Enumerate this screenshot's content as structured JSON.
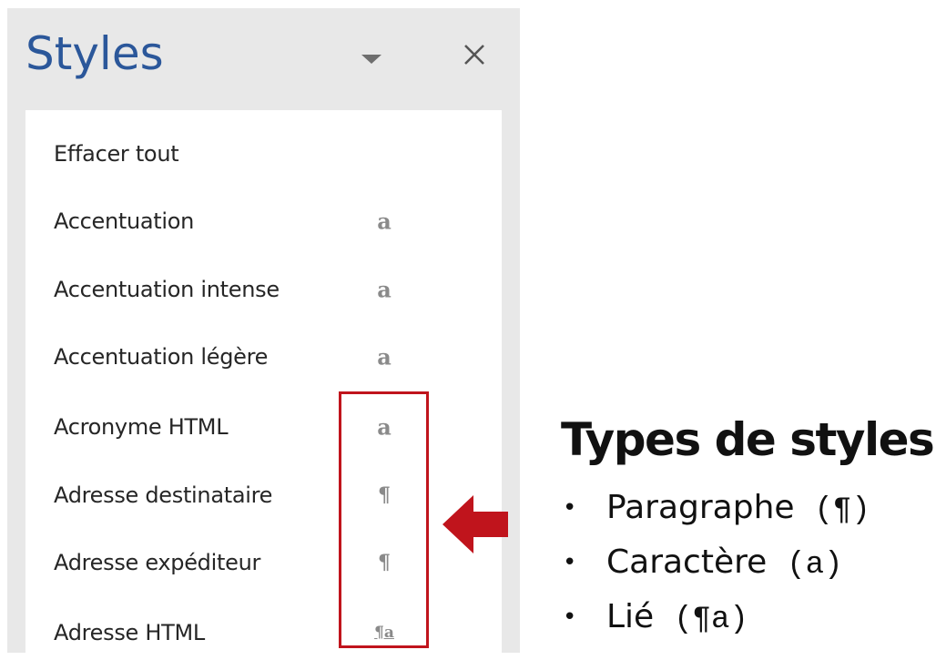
{
  "pane": {
    "title": "Styles",
    "menu_icon": "triangle-down-icon",
    "close_icon": "close-icon"
  },
  "styles_list": [
    {
      "label": "Effacer tout",
      "glyph": ""
    },
    {
      "label": "Accentuation",
      "glyph": "a"
    },
    {
      "label": "Accentuation intense",
      "glyph": "a"
    },
    {
      "label": "Accentuation légère",
      "glyph": "a"
    },
    {
      "label": "Acronyme HTML",
      "glyph": "a"
    },
    {
      "label": "Adresse destinataire",
      "glyph": "¶"
    },
    {
      "label": "Adresse expéditeur",
      "glyph": "¶"
    },
    {
      "label": "Adresse HTML",
      "glyph": "¶a"
    }
  ],
  "legend": {
    "heading": "Types de styles",
    "bullet": "•",
    "items": [
      {
        "name": "Paragraphe",
        "symbol": "(¶)"
      },
      {
        "name": "Caractère",
        "symbol": "(a)"
      },
      {
        "name": "Lié",
        "symbol": "(¶a)"
      }
    ]
  },
  "colors": {
    "title_blue": "#2b579a",
    "highlight_red": "#c0141c",
    "pane_gray": "#e8e8e8"
  }
}
